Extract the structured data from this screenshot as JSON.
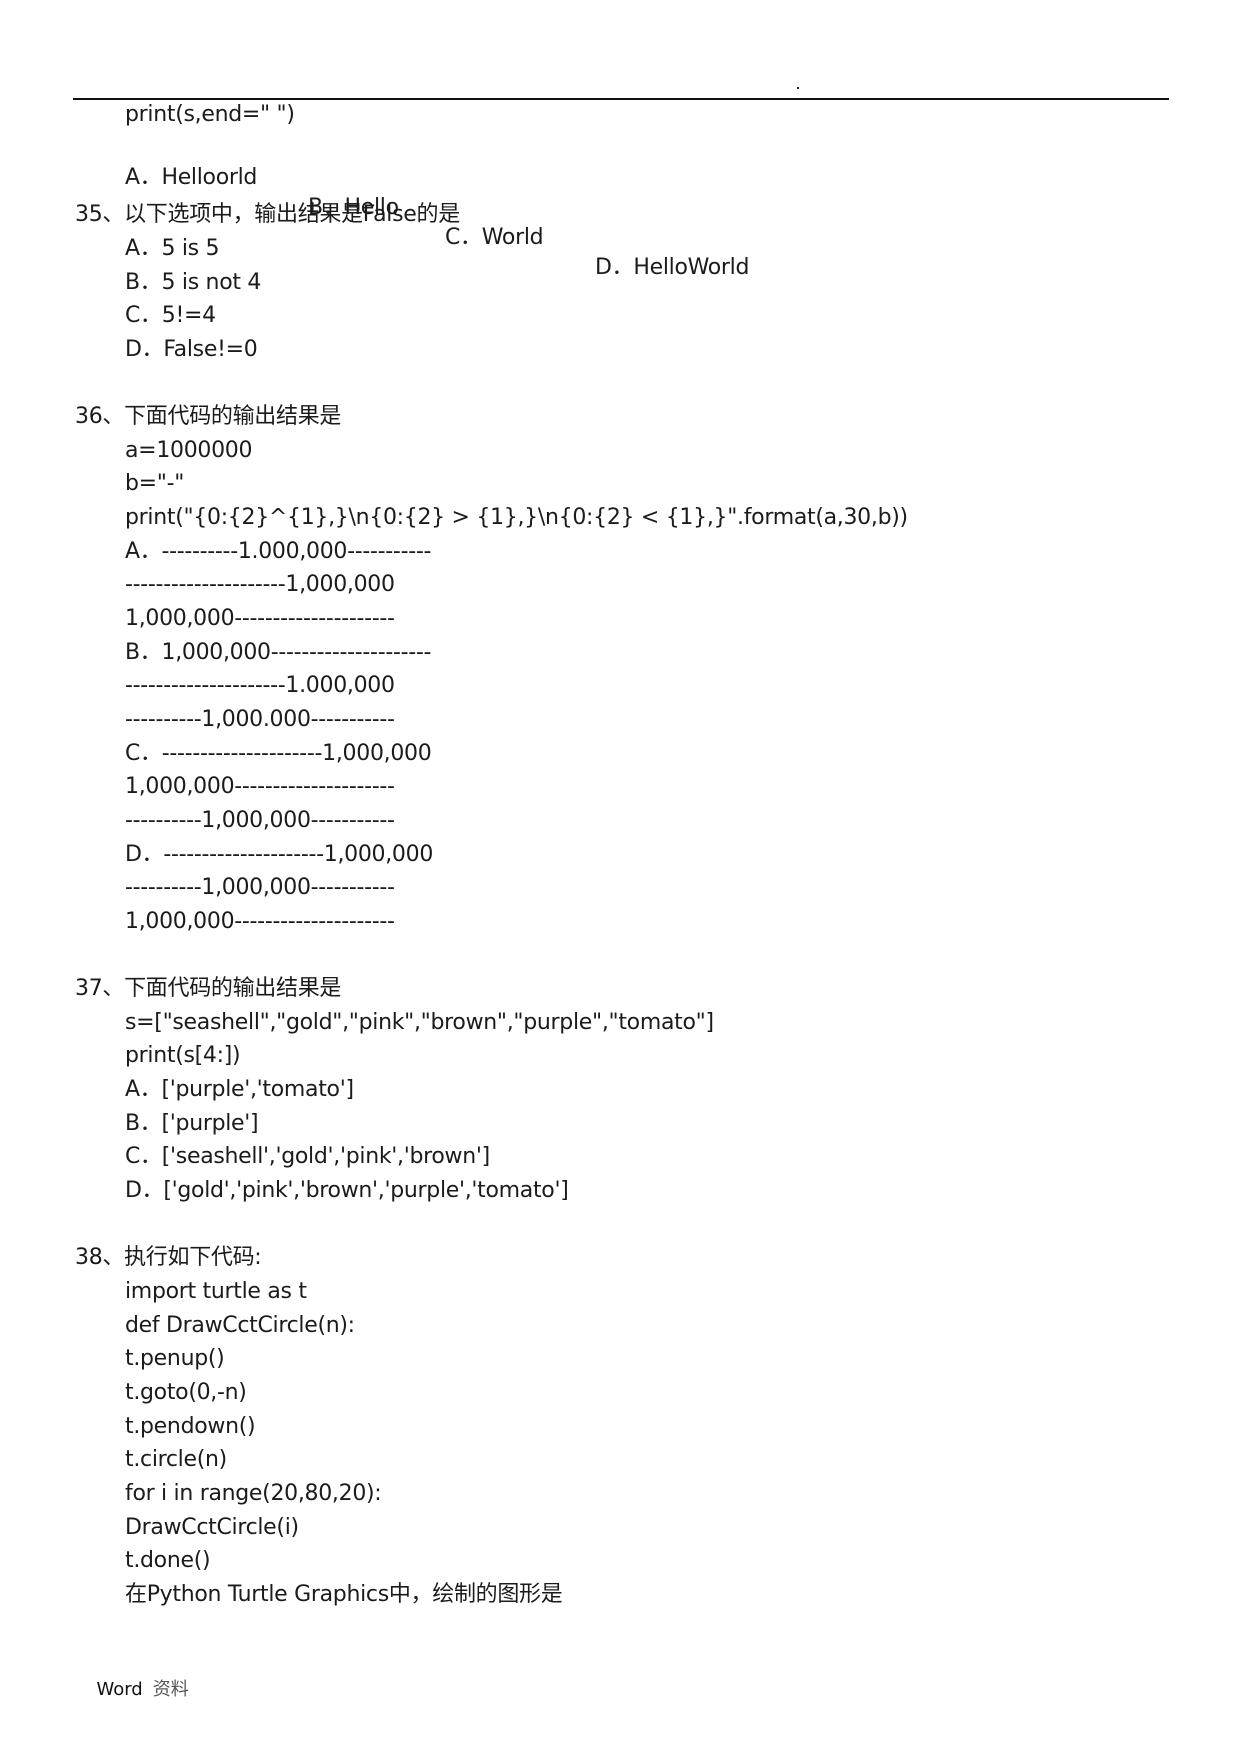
{
  "header": {
    "dot": "."
  },
  "q34_tail": {
    "code": [
      "print(s,end=\" \")"
    ],
    "options": [
      {
        "letter": "A",
        "text": "A．Helloorld"
      },
      {
        "letter": "B",
        "text": "B．Hello"
      },
      {
        "letter": "C",
        "text": "C．World"
      },
      {
        "letter": "D",
        "text": "D．HelloWorld"
      }
    ]
  },
  "q35": {
    "title": "35、以下选项中，输出结果是False的是",
    "options": [
      "A．5 is 5",
      "B．5 is not 4",
      "C．5!=4",
      "D．False!=0"
    ]
  },
  "q36": {
    "title": "36、下面代码的输出结果是",
    "code": [
      "a=1000000",
      "b=\"-\"",
      "print(\"{0:{2}^{1},}\\n{0:{2} > {1},}\\n{0:{2} < {1},}\".format(a,30,b))"
    ],
    "options": [
      [
        "A．----------1.000,000-----------",
        "---------------------1,000,000",
        "1,000,000---------------------"
      ],
      [
        "B．1,000,000---------------------",
        "---------------------1.000,000",
        "----------1,000.000-----------"
      ],
      [
        "C．---------------------1,000,000",
        "1,000,000---------------------",
        "----------1,000,000-----------"
      ],
      [
        "D．---------------------1,000,000",
        "----------1,000,000-----------",
        "1,000,000---------------------"
      ]
    ]
  },
  "q37": {
    "title": "37、下面代码的输出结果是",
    "code": [
      "s=[\"seashell\",\"gold\",\"pink\",\"brown\",\"purple\",\"tomato\"]",
      "print(s[4:])"
    ],
    "options": [
      "A．['purple','tomato']",
      "B．['purple']",
      "C．['seashell','gold','pink','brown']",
      "D．['gold','pink','brown','purple','tomato']"
    ]
  },
  "q38": {
    "title": "38、执行如下代码:",
    "code": [
      "import turtle as t",
      "def DrawCctCircle(n):",
      "t.penup()",
      "t.goto(0,-n)",
      "t.pendown()",
      "t.circle(n)",
      "for i in range(20,80,20):",
      "DrawCctCircle(i)",
      "t.done()",
      "在Python Turtle Graphics中，绘制的图形是"
    ]
  },
  "footer": {
    "label": "Word",
    "label_cn": "资料"
  }
}
